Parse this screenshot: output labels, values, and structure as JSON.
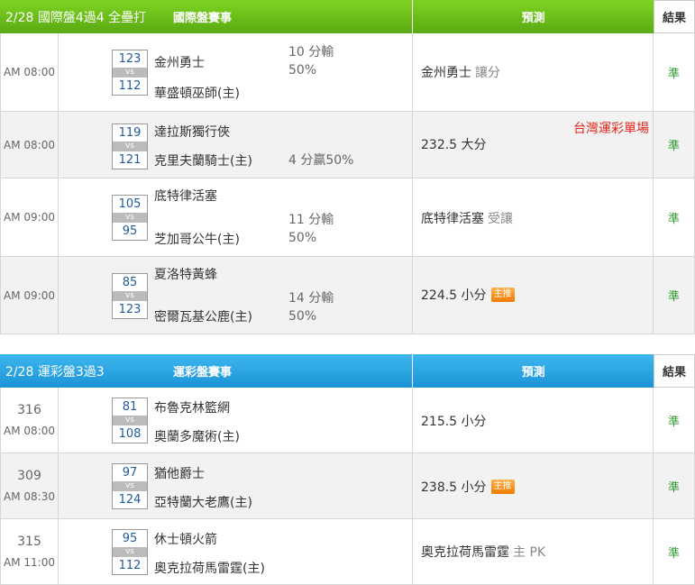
{
  "intl": {
    "date": "2/28 國際盤4過4 全壘打",
    "mid": "國際盤賽事",
    "pred": "預測",
    "res": "結果",
    "rows": [
      {
        "time": "AM 08:00",
        "s1": "123",
        "s2": "112",
        "t1": "金州勇士",
        "t2": "華盛頓巫師(主)",
        "h1": "10 分輸",
        "h2": "50%",
        "pred": "金州勇士",
        "psub": "讓分",
        "badge": "",
        "note": "",
        "res": "準"
      },
      {
        "time": "AM 08:00",
        "s1": "119",
        "s2": "121",
        "t1": "達拉斯獨行俠",
        "t2": "克里夫蘭騎士(主)",
        "h1": "",
        "h2": "4 分贏50%",
        "pred": "232.5 大分",
        "psub": "",
        "badge": "",
        "note": "台灣運彩單場",
        "res": "準"
      },
      {
        "time": "AM 09:00",
        "s1": "105",
        "s2": "95",
        "t1": "底特律活塞",
        "t2": "芝加哥公牛(主)",
        "h1": "11 分輸",
        "h2": "50%",
        "pred": "底特律活塞",
        "psub": "受讓",
        "badge": "",
        "note": "",
        "res": "準"
      },
      {
        "time": "AM 09:00",
        "s1": "85",
        "s2": "123",
        "t1": "夏洛特黃蜂",
        "t2": "密爾瓦基公鹿(主)",
        "h1": "14 分輸",
        "h2": "50%",
        "pred": "224.5 小分",
        "psub": "",
        "badge": "主推",
        "note": "",
        "res": "準"
      }
    ]
  },
  "lottery": {
    "date": "2/28 運彩盤3過3",
    "mid": "運彩盤賽事",
    "pred": "預測",
    "res": "結果",
    "rows": [
      {
        "num": "316",
        "time": "AM 08:00",
        "s1": "81",
        "s2": "108",
        "t1": "布魯克林籃網",
        "t2": "奧蘭多魔術(主)",
        "pred": "215.5 小分",
        "psub": "",
        "badge": "",
        "res": "準"
      },
      {
        "num": "309",
        "time": "AM 08:30",
        "s1": "97",
        "s2": "124",
        "t1": "猶他爵士",
        "t2": "亞特蘭大老鷹(主)",
        "pred": "238.5 小分",
        "psub": "",
        "badge": "主推",
        "res": "準"
      },
      {
        "num": "315",
        "time": "AM 11:00",
        "s1": "95",
        "s2": "112",
        "t1": "休士頓火箭",
        "t2": "奧克拉荷馬雷霆(主)",
        "pred": "奧克拉荷馬雷霆",
        "psub": "主 PK",
        "badge": "",
        "res": "準"
      }
    ]
  }
}
